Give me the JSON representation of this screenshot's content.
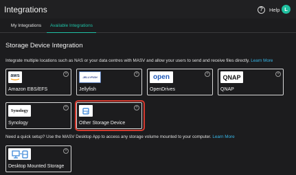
{
  "header": {
    "title": "Integrations",
    "help_icon_glyph": "?",
    "help_label": "Help",
    "avatar_initial": "L",
    "avatar_color": "#1fbf9f"
  },
  "tabs": [
    {
      "label": "My Integrations",
      "active": false
    },
    {
      "label": "Available Integrations",
      "active": true
    }
  ],
  "accent_color": "#1fc2a6",
  "section": {
    "title": "Storage Device Integration",
    "description": "Integrate multiple locations such as NAS or your data centres with MASV and allow your users to send and receive files directly.",
    "learn_more": "Learn More"
  },
  "storage_cards": [
    {
      "name": "Amazon EBS/EFS",
      "icon": "aws-logo-icon",
      "logo_text": "aws"
    },
    {
      "name": "Jellyfish",
      "icon": "jellyfish-logo-icon",
      "logo_text": "JELLYFISH"
    },
    {
      "name": "OpenDrives",
      "icon": "opendrives-logo-icon",
      "logo_text": "open"
    },
    {
      "name": "QNAP",
      "icon": "qnap-logo-icon",
      "logo_text": "QNAP"
    },
    {
      "name": "Synology",
      "icon": "synology-logo-icon",
      "logo_text": "Synology"
    },
    {
      "name": "Other Storage Device",
      "icon": "storage-device-icon",
      "logo_text": "",
      "highlighted": true
    }
  ],
  "quick_setup": {
    "description": "Need a quick setup? Use the MASV Desktop App to access any storage volume mounted to your computer.",
    "learn_more": "Learn More",
    "card": {
      "name": "Desktop Mounted Storage",
      "icon": "desktop-storage-icon"
    }
  },
  "highlight_color": "#d63a2f",
  "plus_glyph": "+"
}
